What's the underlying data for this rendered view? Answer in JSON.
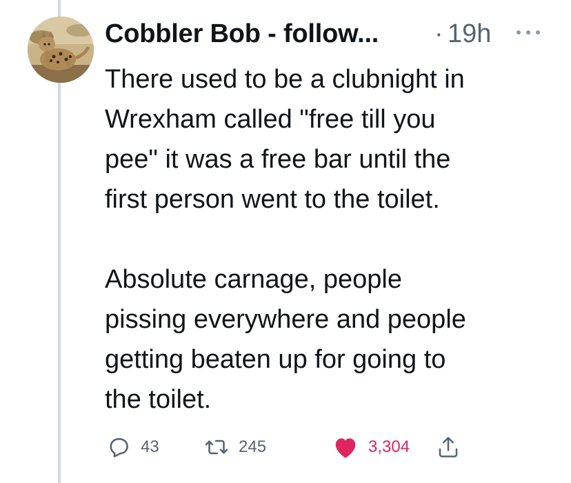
{
  "tweet": {
    "display_name": "Cobbler Bob - follow...",
    "separator": "·",
    "timestamp": "19h",
    "more_icon": "more-horizontal-icon",
    "avatar_icon": "wildcat-avatar",
    "text": "There used to be a clubnight in\nWrexham called \"free till you\npee\" it was a free bar until the\nfirst person went to the toilet.\n\nAbsolute carnage, people\npissing everywhere and people\ngetting beaten up for going to\nthe toilet."
  },
  "actions": {
    "reply": {
      "icon": "reply-icon",
      "count": "43"
    },
    "retweet": {
      "icon": "retweet-icon",
      "count": "245"
    },
    "like": {
      "icon": "heart-icon",
      "count": "3,304",
      "color": "#e0245e"
    },
    "share": {
      "icon": "share-icon"
    }
  },
  "colors": {
    "text": "#0f1419",
    "secondary": "#536471",
    "thread_line": "#cfd9de",
    "like": "#e0245e"
  }
}
